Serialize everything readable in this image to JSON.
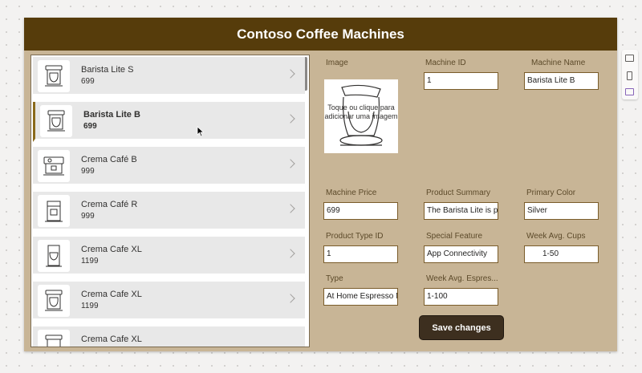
{
  "app": {
    "title": "Contoso Coffee Machines",
    "colors": {
      "header": "#563c0b",
      "canvas": "#c8b596",
      "button": "#3d2f1f"
    }
  },
  "gallery": {
    "items": [
      {
        "name": "Barista Lite S",
        "price": "699",
        "icon": "coffee-machine-icon"
      },
      {
        "name": "Barista Lite B",
        "price": "699",
        "icon": "coffee-machine-icon",
        "selected": true
      },
      {
        "name": "Crema Café B",
        "price": "999",
        "icon": "espresso-machine-icon"
      },
      {
        "name": "Crema Café R",
        "price": "999",
        "icon": "espresso-machine-icon"
      },
      {
        "name": "Crema Cafe XL",
        "price": "1199",
        "icon": "coffee-machine-icon"
      },
      {
        "name": "Crema Cafe XL",
        "price": "1199",
        "icon": "coffee-machine-icon"
      },
      {
        "name": "Crema Cafe XL",
        "price": "",
        "icon": "coffee-machine-icon"
      }
    ]
  },
  "form": {
    "image_label": "Image",
    "image_hint": "Toque ou clique para adicionar uma imagem",
    "machine_id_label": "Machine ID",
    "machine_id_value": "1",
    "machine_name_label": "Machine Name",
    "machine_name_value": "Barista Lite B",
    "machine_price_label": "Machine Price",
    "machine_price_value": "699",
    "product_summary_label": "Product Summary",
    "product_summary_value": "The Barista Lite is pe",
    "primary_color_label": "Primary Color",
    "primary_color_value": "Silver",
    "product_type_id_label": "Product Type ID",
    "product_type_id_value": "1",
    "special_feature_label": "Special Feature",
    "special_feature_value": "App Connectivity",
    "week_avg_cups_label": "Week Avg. Cups",
    "week_avg_cups_value": "1-50",
    "type_label": "Type",
    "type_value": "At Home Espresso M",
    "week_avg_espresso_label": "Week Avg. Espres...",
    "week_avg_espresso_value": "1-100",
    "save_label": "Save changes"
  }
}
